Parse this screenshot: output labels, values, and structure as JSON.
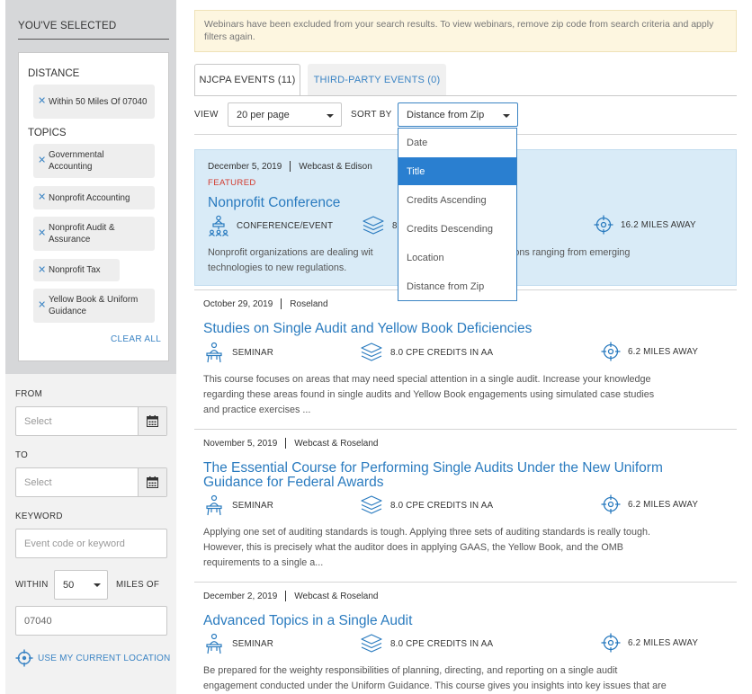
{
  "sidebar": {
    "selected_title": "YOU'VE SELECTED",
    "distance_head": "DISTANCE",
    "distance_chip": "Within 50 Miles Of 07040",
    "topics_head": "TOPICS",
    "topics": [
      "Governmental Accounting",
      "Nonprofit Accounting",
      "Nonprofit Audit & Assurance",
      "Nonprofit Tax",
      "Yellow Book & Uniform Guidance"
    ],
    "clear_all": "CLEAR ALL",
    "from_label": "FROM",
    "from_placeholder": "Select",
    "to_label": "TO",
    "to_placeholder": "Select",
    "keyword_label": "KEYWORD",
    "keyword_placeholder": "Event code or keyword",
    "within_label": "WITHIN",
    "within_value": "50",
    "miles_of_label": "MILES OF",
    "zip_value": "07040",
    "use_location": "USE MY CURRENT LOCATION"
  },
  "notice": "Webinars have been excluded from your search results. To view webinars, remove zip code from search criteria and apply filters again.",
  "tabs": [
    {
      "label": "NJCPA EVENTS (11)",
      "active": true
    },
    {
      "label": "THIRD-PARTY EVENTS (0)",
      "active": false
    }
  ],
  "controls": {
    "view_label": "VIEW",
    "per_page": "20 per page",
    "sort_label": "SORT BY",
    "sort_value": "Distance from Zip"
  },
  "sort_options": [
    "Date",
    "Title",
    "Credits Ascending",
    "Credits Descending",
    "Location",
    "Distance from Zip"
  ],
  "sort_active_index": 1,
  "results": [
    {
      "date": "December 5, 2019",
      "location": "Webcast & Edison",
      "featured": "FEATURED",
      "title": "Nonprofit Conference",
      "type": "CONFERENCE/EVENT",
      "credits": "8",
      "distance": "16.2 MILES AWAY",
      "desc_left": "Nonprofit organizations are dealing wit",
      "desc_right": "rizons ranging from emerging",
      "desc_line2": "technologies to new regulations."
    },
    {
      "date": "October 29, 2019",
      "location": "Roseland",
      "title": "Studies on Single Audit and Yellow Book Deficiencies",
      "type": "SEMINAR",
      "credits": "8.0 CPE CREDITS IN AA",
      "distance": "6.2 MILES AWAY",
      "desc": [
        "This course focuses on areas that may need special attention in a single audit. Increase your knowledge",
        "regarding these areas found in single audits and Yellow Book engagements using simulated case studies",
        "and practice exercises ..."
      ]
    },
    {
      "date": "November 5, 2019",
      "location": "Webcast & Roseland",
      "title_lines": [
        "The Essential Course for Performing Single Audits Under the New Uniform",
        "Guidance for Federal Awards"
      ],
      "type": "SEMINAR",
      "credits": "8.0 CPE CREDITS IN AA",
      "distance": "6.2 MILES AWAY",
      "desc": [
        "Applying one set of auditing standards is tough. Applying three sets of auditing standards is really tough.",
        "However, this is precisely what the auditor does in applying GAAS, the Yellow Book, and the OMB",
        "requirements to a single a..."
      ]
    },
    {
      "date": "December 2, 2019",
      "location": "Webcast & Roseland",
      "title": "Advanced Topics in a Single Audit",
      "type": "SEMINAR",
      "credits": "8.0 CPE CREDITS IN AA",
      "distance": "6.2 MILES AWAY",
      "desc": [
        "Be prepared for the weighty responsibilities of planning, directing, and reporting on a single audit",
        "engagement conducted under the Uniform Guidance. This course gives you insights into key issues that are"
      ]
    }
  ],
  "colors": {
    "link": "#2a7bbf",
    "featured": "#d23a2e",
    "active_option": "#2a7fd0"
  }
}
